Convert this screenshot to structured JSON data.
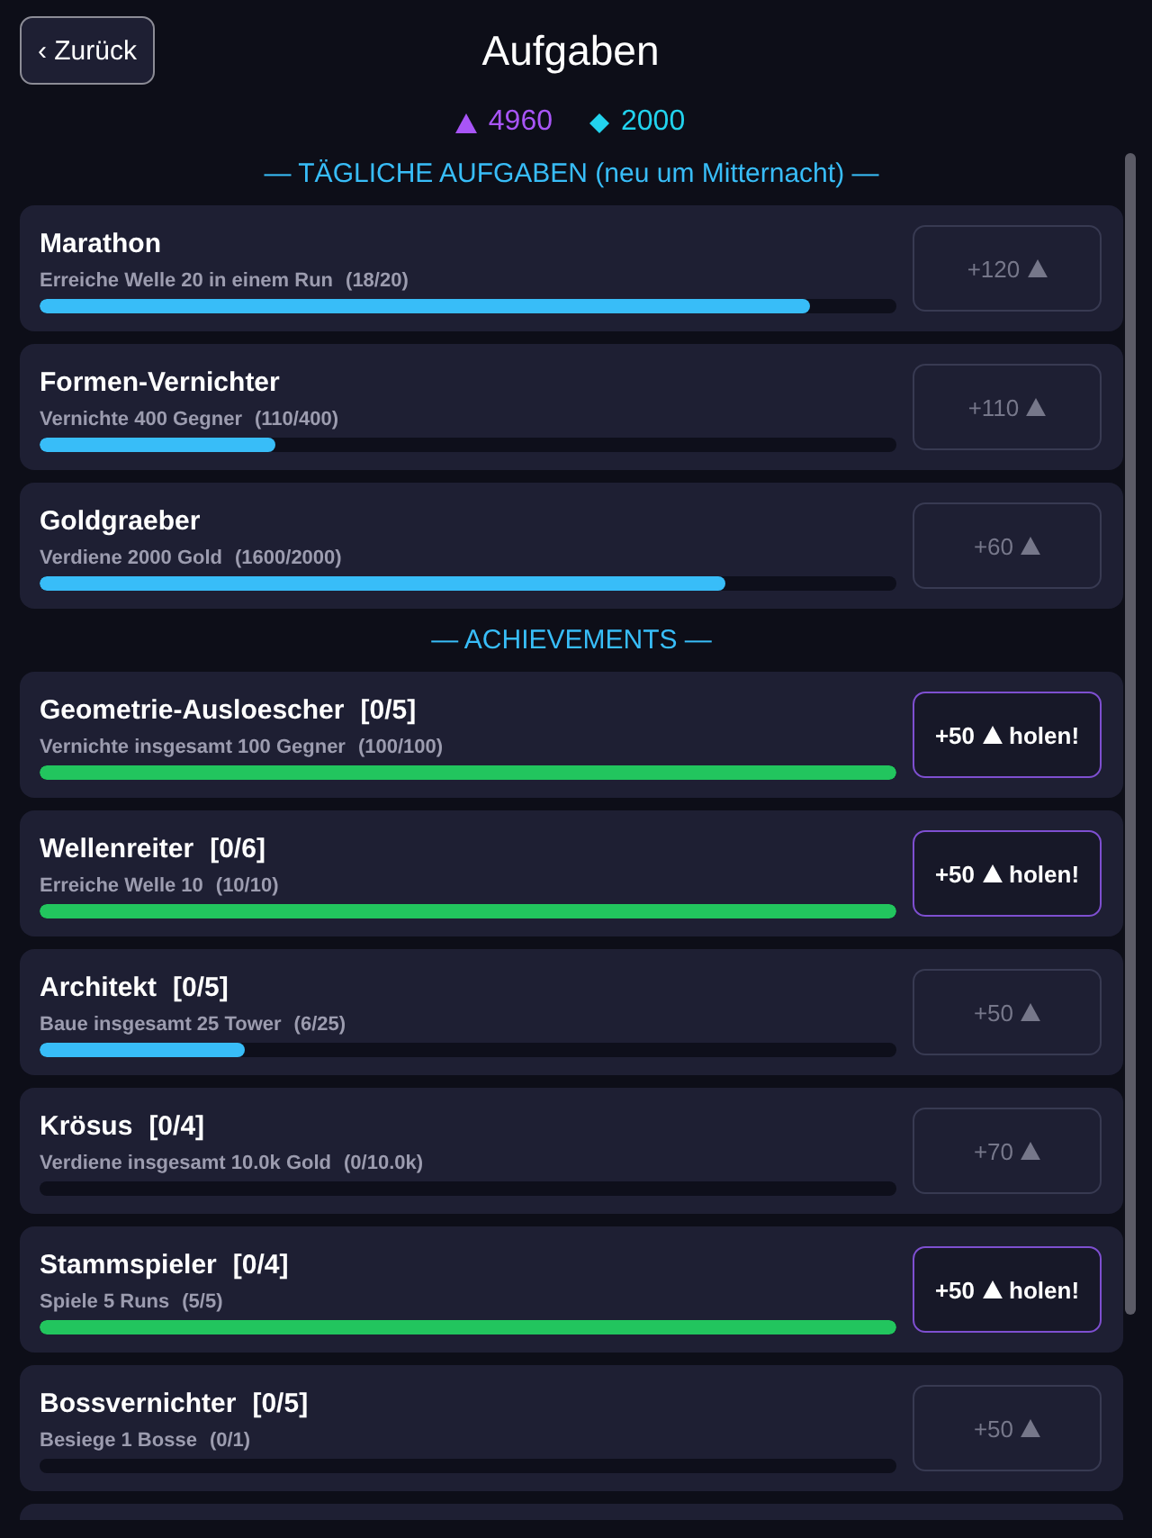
{
  "header": {
    "back_label": "‹ Zurück",
    "title": "Aufgaben"
  },
  "currencies": [
    {
      "kind": "triangle",
      "amount": "4960",
      "color": "#a855f7"
    },
    {
      "kind": "diamond",
      "amount": "2000",
      "color": "#22d3ee"
    }
  ],
  "sections": [
    {
      "heading": "— TÄGLICHE AUFGABEN (neu um Mitternacht) —",
      "quests": [
        {
          "title": "Marathon",
          "description": "Erreiche Welle 20 in einem Run",
          "progress": "(18/20)",
          "level": 0.9,
          "reward": "+120",
          "claimable": false
        },
        {
          "title": "Formen-Vernichter",
          "description": "Vernichte 400 Gegner",
          "progress": "(110/400)",
          "level": 0.275,
          "reward": "+110",
          "claimable": false
        },
        {
          "title": "Goldgraeber",
          "description": "Verdiene 2000 Gold",
          "progress": "(1600/2000)",
          "level": 0.8,
          "reward": "+60",
          "claimable": false
        }
      ]
    },
    {
      "heading": "— ACHIEVEMENTS —",
      "more_below": true,
      "quests": [
        {
          "title": "Geometrie-Ausloescher",
          "tier": "[0/5]",
          "description": "Vernichte insgesamt 100 Gegner",
          "progress": "(100/100)",
          "level": 1,
          "reward": "+50",
          "claim_label": "holen!",
          "claimable": true
        },
        {
          "title": "Wellenreiter",
          "tier": "[0/6]",
          "description": "Erreiche Welle 10",
          "progress": "(10/10)",
          "level": 1,
          "reward": "+50",
          "claim_label": "holen!",
          "claimable": true
        },
        {
          "title": "Architekt",
          "tier": "[0/5]",
          "description": "Baue insgesamt 25 Tower",
          "progress": "(6/25)",
          "level": 0.24,
          "reward": "+50",
          "claimable": false
        },
        {
          "title": "Krösus",
          "tier": "[0/4]",
          "description": "Verdiene insgesamt 10.0k Gold",
          "progress": "(0/10.0k)",
          "level": 0,
          "reward": "+70",
          "claimable": false
        },
        {
          "title": "Stammspieler",
          "tier": "[0/4]",
          "description": "Spiele 5 Runs",
          "progress": "(5/5)",
          "level": 1,
          "reward": "+50",
          "claim_label": "holen!",
          "claimable": true
        },
        {
          "title": "Bossvernichter",
          "tier": "[0/5]",
          "description": "Besiege 1 Bosse",
          "progress": "(0/1)",
          "level": 0,
          "reward": "+50",
          "claimable": false
        }
      ]
    }
  ]
}
